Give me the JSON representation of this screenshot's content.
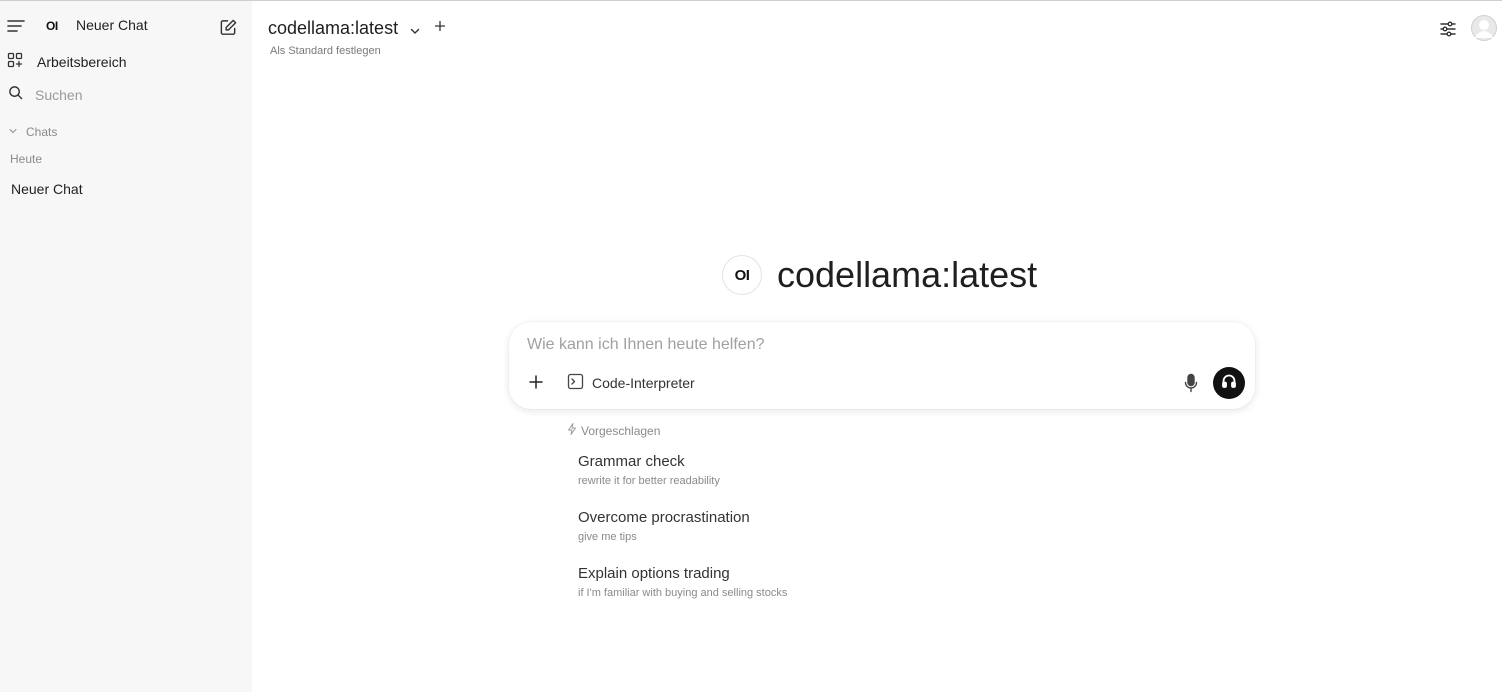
{
  "sidebar": {
    "logo_text": "OI",
    "new_chat_title": "Neuer Chat",
    "workspace_label": "Arbeitsbereich",
    "search_placeholder": "Suchen",
    "chats_section_label": "Chats",
    "group_today_label": "Heute",
    "chats": [
      {
        "title": "Neuer Chat"
      }
    ]
  },
  "header": {
    "model_name": "codellama:latest",
    "set_default_label": "Als Standard festlegen"
  },
  "hero": {
    "logo_text": "OI",
    "model_name": "codellama:latest"
  },
  "composer": {
    "placeholder": "Wie kann ich Ihnen heute helfen?",
    "tool_label": "Code-Interpreter"
  },
  "suggestions": {
    "header_label": "Vorgeschlagen",
    "items": [
      {
        "title": "Grammar check",
        "subtitle": "rewrite it for better readability"
      },
      {
        "title": "Overcome procrastination",
        "subtitle": "give me tips"
      },
      {
        "title": "Explain options trading",
        "subtitle": "if I'm familiar with buying and selling stocks"
      }
    ]
  },
  "icons": {
    "menu": "menu-icon",
    "edit": "edit-icon",
    "workspace": "grid-plus-icon",
    "search": "search-icon",
    "chevron": "chevron-down-icon",
    "plus": "plus-icon",
    "settings": "sliders-icon",
    "avatar": "user-avatar-icon",
    "terminal": "terminal-icon",
    "mic": "microphone-icon",
    "voice": "headphones-icon",
    "sparkle": "sparkle-icon"
  },
  "colors": {
    "sidebar_bg": "#f7f7f7",
    "voice_button_bg": "#111111",
    "muted_text": "#8a8a8a"
  }
}
